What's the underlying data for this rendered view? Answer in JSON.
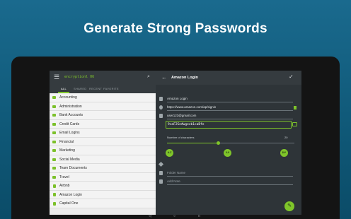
{
  "headline": "Generate Strong Passwords",
  "app": {
    "name": "encryptionl 06",
    "tabs": [
      "ALL",
      "SHARED",
      "RECENT",
      "FAVORITE"
    ],
    "list_items": [
      {
        "label": "Accounting",
        "icon": "folder-icon"
      },
      {
        "label": "Administration",
        "icon": "folder-icon"
      },
      {
        "label": "Bank Accounts",
        "icon": "folder-icon"
      },
      {
        "label": "Credit Cards",
        "icon": "folder-icon"
      },
      {
        "label": "Email Logins",
        "icon": "folder-icon"
      },
      {
        "label": "Financial",
        "icon": "folder-icon"
      },
      {
        "label": "Marketing",
        "icon": "folder-icon"
      },
      {
        "label": "Social Media",
        "icon": "folder-icon"
      },
      {
        "label": "Team Documents",
        "icon": "folder-icon"
      },
      {
        "label": "Travel",
        "icon": "folder-icon"
      },
      {
        "label": "Airbnb",
        "icon": "file-icon"
      },
      {
        "label": "Amazon Login",
        "icon": "file-icon"
      },
      {
        "label": "Capital One",
        "icon": "file-icon"
      }
    ]
  },
  "detail": {
    "title": "Amazon Login",
    "name_value": "Amazon Login",
    "url_value": "https://www.amazon.com/ap/signin",
    "username_value": "user123@gmail.com",
    "password_value": "9caF2Sn#wgecb1caBfe",
    "num_chars_label": "Number of characters",
    "num_chars_value": "20",
    "options": [
      "A-Z",
      "0-9",
      "$#*"
    ],
    "folder_placeholder": "Folder Name",
    "notes_placeholder": "Add Note"
  },
  "colors": {
    "accent": "#7fc52a",
    "background": "#0f5877"
  }
}
